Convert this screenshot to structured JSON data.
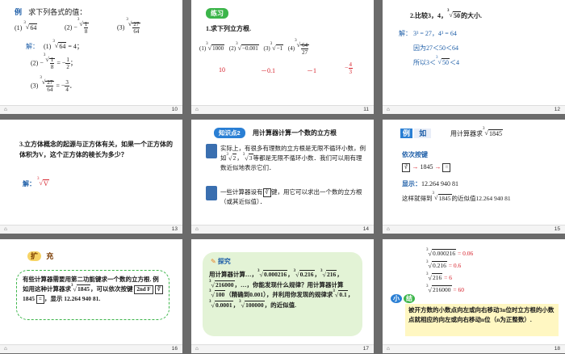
{
  "slides": [
    {
      "number": "10",
      "example_label": "例",
      "title": "求下列各式的值：",
      "q1_label": "(1)",
      "q1_radicand": "64",
      "q2_label": "(2)",
      "q2_num": "1",
      "q2_den": "8",
      "q3_label": "(3)",
      "q3_num": "27",
      "q3_den": "64",
      "solution_label": "解：",
      "a1_label": "(1)",
      "a1_radicand": "64",
      "a1_result": "= 4；",
      "a2_label": "(2)",
      "a2_result_num": "1",
      "a2_result_den": "2",
      "a2_end": "；",
      "a3_label": "(3)",
      "a3_result_num": "3",
      "a3_result_den": "4",
      "a3_end": "．"
    },
    {
      "number": "11",
      "badge": "练习",
      "title": "1.求下列立方根.",
      "q1": "(1)",
      "q1_radicand": "1000",
      "q2": "(2)",
      "q2_radicand": "−0.001",
      "q3": "(3)",
      "q3_radicand": "−1",
      "q4": "(4)",
      "q4_num": "64",
      "q4_den": "27",
      "a1": "10",
      "a2": "－0.1",
      "a3": "－1",
      "a4_num": "4",
      "a4_den": "3"
    },
    {
      "number": "12",
      "line1_a": "2.比较3，4，",
      "line1_radicand": "50",
      "line1_b": "的大小.",
      "solution_label": "解：",
      "line2": "3³ = 27，4³ = 64",
      "line3": "因为27＜50＜64",
      "line4_a": "所以3＜",
      "line4_radicand": "50",
      "line4_b": "＜4"
    },
    {
      "number": "13",
      "question": "3.立方体概念的起源与正方体有关，如果一个正方体的体积为V，这个正方体的棱长为多少？",
      "solution_label": "解：",
      "answer_radicand": "V"
    },
    {
      "number": "14",
      "knowledge_badge": "知识点2",
      "heading": "用计算器计算一个数的立方根",
      "para1": "实际上，有很多有理数的立方根是无限不循环小数，例如",
      "para1_r1": "2",
      "para1_mid": "，",
      "para1_r2": "3",
      "para1_tail": "等都是无限不循环小数．我们可以用有理数近似地表示它们．",
      "para2_a": "一些计算器设有",
      "para2_key": "∛",
      "para2_b": "键，用它可以求出一个数的立方根（或其近似值）．"
    },
    {
      "number": "15",
      "ex_label_a": "例",
      "ex_label_b": "如",
      "ex_text": "用计算器求",
      "ex_radicand": "1845",
      "step_title": "依次按键",
      "key1": "∛",
      "arrow1": "→",
      "key_value": "1845",
      "arrow2": "→",
      "key2": "=",
      "display_label": "显示：",
      "display_value": "12.264 940 81",
      "result_a": "这样就得到",
      "result_radicand": "1845",
      "result_b": "的近似值12.264 940 81"
    },
    {
      "number": "16",
      "tag_a": "扩",
      "tag_b": "充",
      "text_a": "有些计算器需要用第二功能键求一个数的立方根. 例如用这种计算器求",
      "text_radicand": "1845",
      "text_b": "，可以依次按键",
      "key_2ndf": "2nd F",
      "key_root": "∛",
      "key_val": "1845",
      "key_eq": "=",
      "text_c": "，显示",
      "display": "12.264 940 81."
    },
    {
      "number": "17",
      "badge": "探究",
      "line1_a": "用计算器计算…，",
      "r1": "0.000216",
      "r2": "0.216",
      "r3": "216",
      "r4": "216000",
      "line2_b": "，…，你能发现什么规律？用计算器计算",
      "r5": "100",
      "line3_b": "（精确到0.001），并利用你发现的规律求",
      "r6": "0.1",
      "r7": "0.0001",
      "r8": "100000",
      "line4_b": "，的近似值."
    },
    {
      "number": "18",
      "rows": [
        {
          "radicand": "0.000216",
          "value": "= 0.06"
        },
        {
          "radicand": "0.216",
          "value": "= 0.6"
        },
        {
          "radicand": "216",
          "value": "= 6"
        },
        {
          "radicand": "216000",
          "value": "= 60"
        }
      ],
      "summary_a": "小",
      "summary_b": "结",
      "summary_text": "被开方数的小数点向左或向右移动3n位时立方根的小数点就相应的向左或向右移动n位（n为正整数）."
    }
  ]
}
